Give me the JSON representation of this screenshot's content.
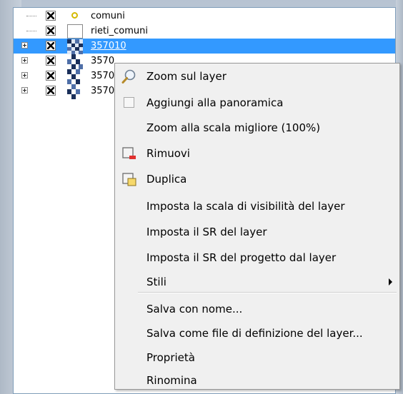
{
  "tree": {
    "layers": [
      {
        "label": "comuni",
        "checked": true,
        "icon": "point-icon",
        "expandable": false,
        "selected": false
      },
      {
        "label": "rieti_comuni",
        "checked": true,
        "icon": "polygon-icon",
        "expandable": false,
        "selected": false
      },
      {
        "label": "357010",
        "checked": true,
        "icon": "raster-icon",
        "expandable": true,
        "selected": true
      },
      {
        "label": "3570",
        "checked": true,
        "icon": "raster-icon",
        "expandable": true,
        "selected": false
      },
      {
        "label": "3570",
        "checked": true,
        "icon": "raster-icon",
        "expandable": true,
        "selected": false
      },
      {
        "label": "3570",
        "checked": true,
        "icon": "raster-icon",
        "expandable": true,
        "selected": false
      }
    ]
  },
  "context_menu": {
    "items": [
      {
        "label": "Zoom sul layer",
        "icon": "zoom-magnifier-icon",
        "enabled": true
      },
      {
        "label": "Aggiungi alla panoramica",
        "icon": "checkbox-unchecked-icon",
        "enabled": true
      },
      {
        "label": "Zoom alla scala migliore (100%)",
        "icon": "",
        "enabled": true
      },
      {
        "label": "Rimuovi",
        "icon": "remove-layer-icon",
        "enabled": true
      },
      {
        "label": "Duplica",
        "icon": "duplicate-layer-icon",
        "enabled": true
      },
      {
        "label": "Imposta la scala di visibilità del layer",
        "icon": "",
        "enabled": true
      },
      {
        "label": "Imposta il SR del layer",
        "icon": "",
        "enabled": true
      },
      {
        "label": "Imposta il SR del progetto dal layer",
        "icon": "",
        "enabled": true
      },
      {
        "label": "Stili",
        "icon": "",
        "enabled": true,
        "submenu": true
      },
      {
        "label": "Salva con nome...",
        "icon": "",
        "enabled": true
      },
      {
        "label": "Salva come file di definizione del layer...",
        "icon": "",
        "enabled": true
      },
      {
        "label": "Proprietà",
        "icon": "",
        "enabled": true
      },
      {
        "label": "Rinomina",
        "icon": "",
        "enabled": true
      }
    ]
  },
  "colors": {
    "selection": "#3399ff",
    "menu_background": "#f0f0f0",
    "point_symbol": "#d4b900",
    "raster_dark": "#1a2f5a",
    "raster_mid": "#4f6fa8"
  }
}
